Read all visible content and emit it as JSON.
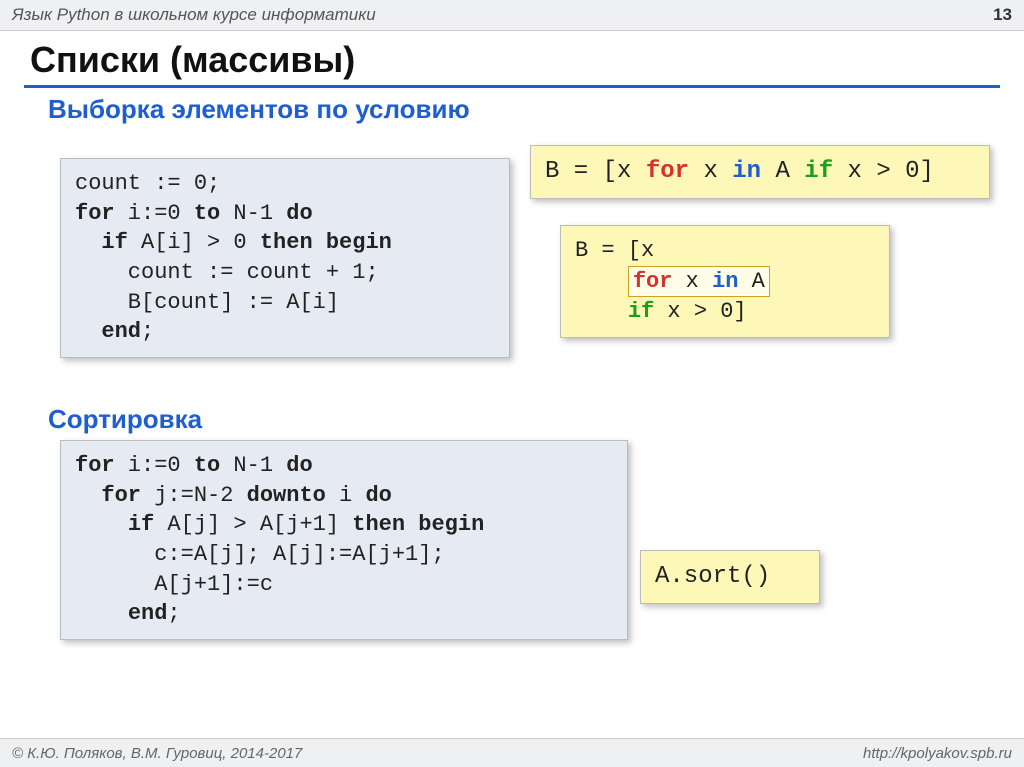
{
  "header": {
    "left": "Язык Python в школьном курсе информатики",
    "page": "13"
  },
  "title": "Списки (массивы)",
  "section1": {
    "heading": "Выборка элементов по условию",
    "pascal": {
      "l1a": "count := 0;",
      "l2a": "for",
      "l2b": " i:=0 ",
      "l2c": "to",
      "l2d": " N-1 ",
      "l2e": "do",
      "l3a": "  ",
      "l3b": "if",
      "l3c": " A[i] > 0 ",
      "l3d": "then begin",
      "l4a": "    count := count + 1;",
      "l5a": "    B[count] := A[i]",
      "l6a": "  ",
      "l6b": "end",
      "l6c": ";"
    },
    "py_one": {
      "a": "B = [x ",
      "for": "for",
      "b": " x ",
      "in": "in",
      "c": " A ",
      "if": "if",
      "d": " x > 0]"
    },
    "py_split": {
      "l1": "B = [x",
      "l2a": "    ",
      "for": "for",
      "l2b": " x ",
      "in": "in",
      "l2c": " A",
      "l3a": "    ",
      "if": "if",
      "l3b": " x > 0]"
    }
  },
  "section2": {
    "heading": "Сортировка",
    "pascal": {
      "l1a": "for",
      "l1b": " i:=0 ",
      "l1c": "to",
      "l1d": " N-1 ",
      "l1e": "do",
      "l2a": "  ",
      "l2b": "for",
      "l2c": " j:=N-2 ",
      "l2d": "downto",
      "l2e": " i ",
      "l2f": "do",
      "l3a": "    ",
      "l3b": "if",
      "l3c": " A[j] > A[j+1] ",
      "l3d": "then begin",
      "l4a": "      c:=A[j]; A[j]:=A[j+1];",
      "l5a": "      A[j+1]:=c",
      "l6a": "    ",
      "l6b": "end",
      "l6c": ";"
    },
    "py": "A.sort()"
  },
  "footer": {
    "left": "© К.Ю. Поляков, В.М. Гуровиц, 2014-2017",
    "right": "http://kpolyakov.spb.ru"
  }
}
